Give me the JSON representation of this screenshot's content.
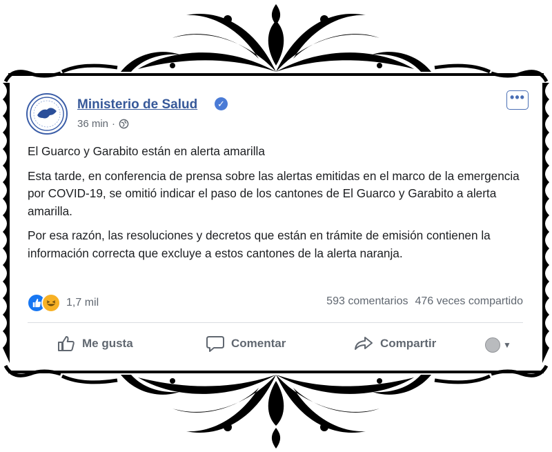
{
  "post": {
    "author": "Ministerio de Salud",
    "verified": true,
    "time": "36 min",
    "audience_icon": "globe-icon",
    "paragraphs": [
      "El Guarco y Garabito están en alerta amarilla",
      "Esta tarde, en conferencia de prensa sobre las alertas emitidas en el marco de la emergencia por COVID-19, se omitió indicar el paso de los cantones de El Guarco y Garabito a alerta amarilla.",
      "Por esa razón, las resoluciones y decretos que están en trámite de emisión contienen la información correcta que excluye a estos cantones de la alerta naranja."
    ],
    "reactions": {
      "icons": [
        "like-reaction-icon",
        "haha-reaction-icon"
      ],
      "count": "1,7 mil"
    },
    "comments": "593 comentarios",
    "shares": "476 veces compartido"
  },
  "actions": {
    "like": "Me gusta",
    "comment": "Comentar",
    "share": "Compartir"
  },
  "colors": {
    "link": "#365899",
    "like_blue": "#1877f2",
    "haha_yellow": "#f7b125",
    "ornament": "#000000"
  }
}
